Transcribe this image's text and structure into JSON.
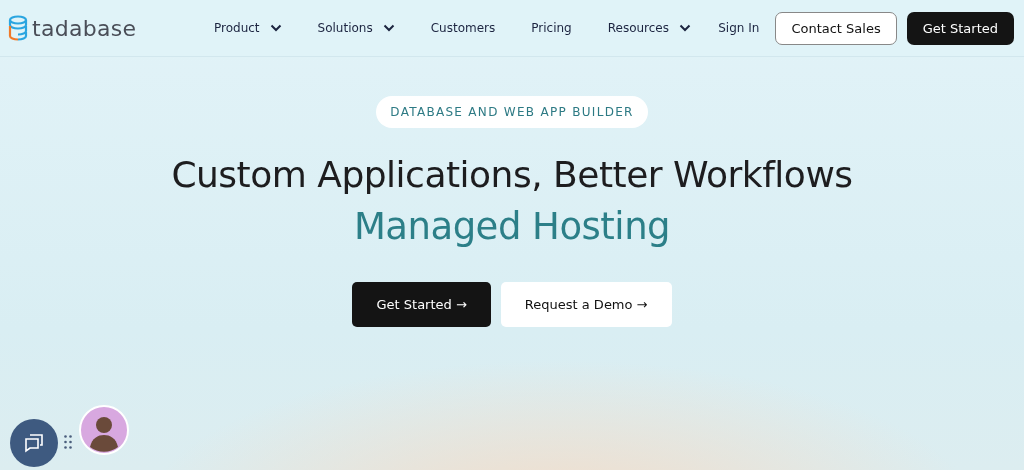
{
  "logo": {
    "text": "tadabase"
  },
  "nav": [
    {
      "label": "Product",
      "dropdown": true
    },
    {
      "label": "Solutions",
      "dropdown": true
    },
    {
      "label": "Customers",
      "dropdown": false
    },
    {
      "label": "Pricing",
      "dropdown": false
    },
    {
      "label": "Resources",
      "dropdown": true
    }
  ],
  "header_actions": {
    "sign_in": "Sign In",
    "contact": "Contact Sales",
    "get_started": "Get Started"
  },
  "hero": {
    "badge": "DATABASE AND WEB APP BUILDER",
    "title": "Custom Applications, Better Workflows",
    "subtitle": "Managed Hosting",
    "buttons": [
      {
        "label": "Get Started →",
        "kind": "primary"
      },
      {
        "label": "Request a Demo →",
        "kind": "secondary"
      }
    ]
  }
}
